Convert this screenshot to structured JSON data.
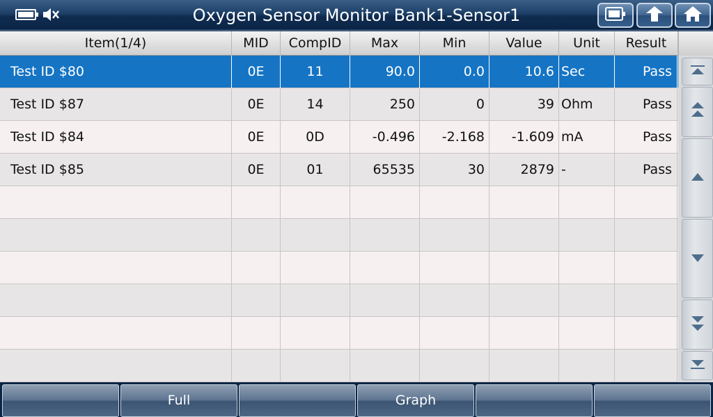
{
  "header": {
    "title": "Oxygen Sensor Monitor Bank1-Sensor1",
    "status_icons": [
      "battery-icon",
      "mute-icon"
    ],
    "buttons": [
      "screenshot-button",
      "back-button",
      "home-button"
    ]
  },
  "table": {
    "columns": [
      "Item(1/4)",
      "MID",
      "CompID",
      "Max",
      "Min",
      "Value",
      "Unit",
      "Result"
    ],
    "rows": [
      {
        "item": "Test ID $80",
        "mid": "0E",
        "compid": "11",
        "max": "90.0",
        "min": "0.0",
        "value": "10.6",
        "unit": "Sec",
        "result": "Pass",
        "selected": true
      },
      {
        "item": "Test ID $87",
        "mid": "0E",
        "compid": "14",
        "max": "250",
        "min": "0",
        "value": "39",
        "unit": "Ohm",
        "result": "Pass"
      },
      {
        "item": "Test ID $84",
        "mid": "0E",
        "compid": "0D",
        "max": "-0.496",
        "min": "-2.168",
        "value": "-1.609",
        "unit": "mA",
        "result": "Pass"
      },
      {
        "item": "Test ID $85",
        "mid": "0E",
        "compid": "01",
        "max": "65535",
        "min": "30",
        "value": "2879",
        "unit": "-",
        "result": "Pass"
      }
    ]
  },
  "scroll": [
    "scroll-top-icon",
    "page-up-icon",
    "line-up-icon",
    "line-down-icon",
    "page-down-icon",
    "scroll-bottom-icon"
  ],
  "bottom": {
    "buttons": [
      "",
      "Full",
      "",
      "Graph",
      "",
      ""
    ]
  },
  "colors": {
    "selected_row": "#1574c4",
    "title_bar": "#0b2546"
  }
}
